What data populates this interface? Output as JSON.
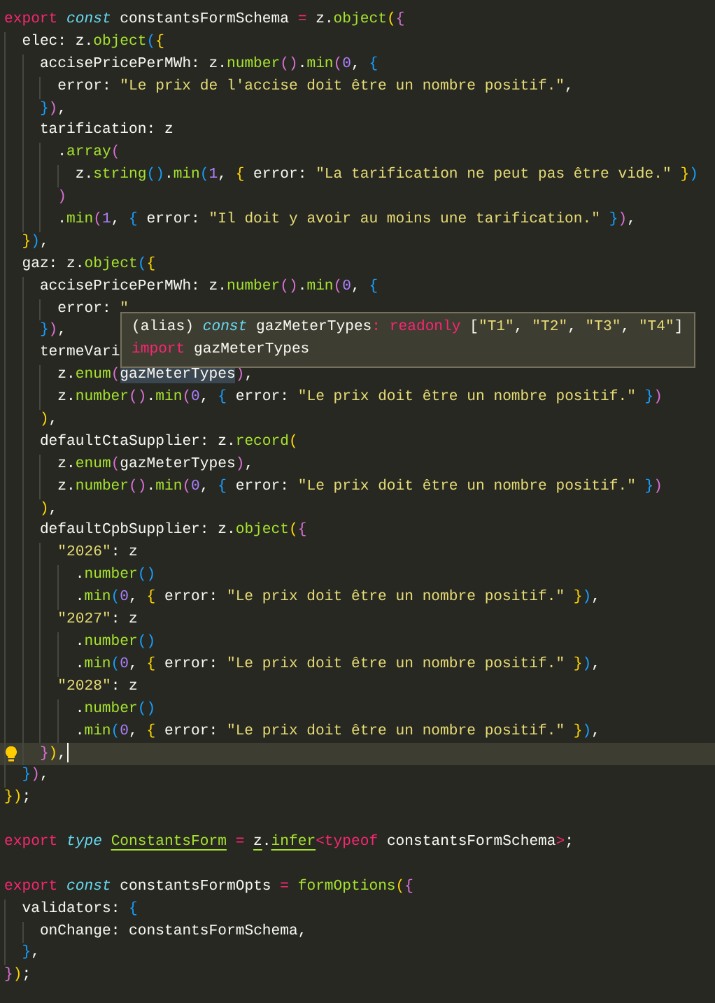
{
  "editor": {
    "blocks": [
      {
        "lines": [
          {
            "current": false,
            "tokens": [
              {
                "kind": "kw",
                "text": "export "
              },
              {
                "kind": "st",
                "text": "const "
              },
              {
                "kind": "p",
                "text": "constantsFormSchema "
              },
              {
                "kind": "op",
                "text": "= "
              },
              {
                "kind": "p",
                "text": "z."
              },
              {
                "kind": "fn",
                "text": "object"
              },
              {
                "kind": "p",
                "text": "({"
              }
            ]
          },
          {
            "current": false,
            "tokens": [
              {
                "kind": "p",
                "text": "  elec: z."
              },
              {
                "kind": "fn",
                "text": "object"
              },
              {
                "kind": "p",
                "text": "({"
              }
            ]
          },
          {
            "current": false,
            "tokens": [
              {
                "kind": "p",
                "text": "    accisePricePerMWh: z."
              },
              {
                "kind": "fn",
                "text": "number"
              },
              {
                "kind": "p",
                "text": "()."
              },
              {
                "kind": "fn",
                "text": "min"
              },
              {
                "kind": "p",
                "text": "("
              },
              {
                "kind": "num",
                "text": "0"
              },
              {
                "kind": "p",
                "text": ", {"
              }
            ]
          },
          {
            "current": false,
            "tokens": [
              {
                "kind": "p",
                "text": "      error: "
              },
              {
                "kind": "str",
                "text": "\"Le prix de l'accise doit être un nombre positif.\""
              },
              {
                "kind": "p",
                "text": ","
              }
            ]
          },
          {
            "current": false,
            "tokens": [
              {
                "kind": "p",
                "text": "    }),"
              }
            ]
          },
          {
            "current": false,
            "tokens": [
              {
                "kind": "p",
                "text": "    tarification: z"
              }
            ]
          },
          {
            "current": false,
            "tokens": [
              {
                "kind": "p",
                "text": "      ."
              },
              {
                "kind": "fn",
                "text": "array"
              },
              {
                "kind": "p",
                "text": "("
              }
            ]
          },
          {
            "current": false,
            "tokens": [
              {
                "kind": "p",
                "text": "        z."
              },
              {
                "kind": "fn",
                "text": "string"
              },
              {
                "kind": "p",
                "text": "()."
              },
              {
                "kind": "fn",
                "text": "min"
              },
              {
                "kind": "p",
                "text": "("
              },
              {
                "kind": "num",
                "text": "1"
              },
              {
                "kind": "p",
                "text": ", { error: "
              },
              {
                "kind": "str",
                "text": "\"La tarification ne peut pas être vide.\""
              },
              {
                "kind": "p",
                "text": " })"
              }
            ]
          },
          {
            "current": false,
            "tokens": [
              {
                "kind": "p",
                "text": "      )"
              }
            ]
          },
          {
            "current": false,
            "tokens": [
              {
                "kind": "p",
                "text": "      ."
              },
              {
                "kind": "fn",
                "text": "min"
              },
              {
                "kind": "p",
                "text": "("
              },
              {
                "kind": "num",
                "text": "1"
              },
              {
                "kind": "p",
                "text": ", { error: "
              },
              {
                "kind": "str",
                "text": "\"Il doit y avoir au moins une tarification.\""
              },
              {
                "kind": "p",
                "text": " }),"
              }
            ]
          },
          {
            "current": false,
            "tokens": [
              {
                "kind": "p",
                "text": "  }),"
              }
            ]
          },
          {
            "current": false,
            "tokens": [
              {
                "kind": "p",
                "text": "  gaz: z."
              },
              {
                "kind": "fn",
                "text": "object"
              },
              {
                "kind": "p",
                "text": "({"
              }
            ]
          },
          {
            "current": false,
            "tokens": [
              {
                "kind": "p",
                "text": "    accisePricePerMWh: z."
              },
              {
                "kind": "fn",
                "text": "number"
              },
              {
                "kind": "p",
                "text": "()."
              },
              {
                "kind": "fn",
                "text": "min"
              },
              {
                "kind": "p",
                "text": "("
              },
              {
                "kind": "num",
                "text": "0"
              },
              {
                "kind": "p",
                "text": ", {"
              }
            ]
          },
          {
            "current": false,
            "tokens": [
              {
                "kind": "p",
                "text": "      error: "
              },
              {
                "kind": "str",
                "text": "\""
              }
            ]
          },
          {
            "current": false,
            "tokens": [
              {
                "kind": "p",
                "text": "    }),"
              }
            ]
          },
          {
            "current": false,
            "tokens": [
              {
                "kind": "p",
                "text": "    termeVari"
              }
            ]
          },
          {
            "current": false,
            "tokens": [
              {
                "kind": "p",
                "text": "      z."
              },
              {
                "kind": "fn",
                "text": "enum"
              },
              {
                "kind": "p",
                "text": "("
              },
              {
                "kind": "hv",
                "text": "gazMeterTypes"
              },
              {
                "kind": "p",
                "text": "),"
              }
            ]
          },
          {
            "current": false,
            "tokens": [
              {
                "kind": "p",
                "text": "      z."
              },
              {
                "kind": "fn",
                "text": "number"
              },
              {
                "kind": "p",
                "text": "()."
              },
              {
                "kind": "fn",
                "text": "min"
              },
              {
                "kind": "p",
                "text": "("
              },
              {
                "kind": "num",
                "text": "0"
              },
              {
                "kind": "p",
                "text": ", { error: "
              },
              {
                "kind": "str",
                "text": "\"Le prix doit être un nombre positif.\""
              },
              {
                "kind": "p",
                "text": " })"
              }
            ]
          },
          {
            "current": false,
            "tokens": [
              {
                "kind": "p",
                "text": "    ),"
              }
            ]
          },
          {
            "current": false,
            "tokens": [
              {
                "kind": "p",
                "text": "    defaultCtaSupplier: z."
              },
              {
                "kind": "fn",
                "text": "record"
              },
              {
                "kind": "p",
                "text": "("
              }
            ]
          },
          {
            "current": false,
            "tokens": [
              {
                "kind": "p",
                "text": "      z."
              },
              {
                "kind": "fn",
                "text": "enum"
              },
              {
                "kind": "p",
                "text": "(gazMeterTypes),"
              }
            ]
          },
          {
            "current": false,
            "tokens": [
              {
                "kind": "p",
                "text": "      z."
              },
              {
                "kind": "fn",
                "text": "number"
              },
              {
                "kind": "p",
                "text": "()."
              },
              {
                "kind": "fn",
                "text": "min"
              },
              {
                "kind": "p",
                "text": "("
              },
              {
                "kind": "num",
                "text": "0"
              },
              {
                "kind": "p",
                "text": ", { error: "
              },
              {
                "kind": "str",
                "text": "\"Le prix doit être un nombre positif.\""
              },
              {
                "kind": "p",
                "text": " })"
              }
            ]
          },
          {
            "current": false,
            "tokens": [
              {
                "kind": "p",
                "text": "    ),"
              }
            ]
          },
          {
            "current": false,
            "tokens": [
              {
                "kind": "p",
                "text": "    defaultCpbSupplier: z."
              },
              {
                "kind": "fn",
                "text": "object"
              },
              {
                "kind": "p",
                "text": "({"
              }
            ]
          },
          {
            "current": false,
            "tokens": [
              {
                "kind": "str",
                "text": "      \"2026\""
              },
              {
                "kind": "p",
                "text": ": z"
              }
            ]
          },
          {
            "current": false,
            "tokens": [
              {
                "kind": "p",
                "text": "        ."
              },
              {
                "kind": "fn",
                "text": "number"
              },
              {
                "kind": "p",
                "text": "()"
              }
            ]
          },
          {
            "current": false,
            "tokens": [
              {
                "kind": "p",
                "text": "        ."
              },
              {
                "kind": "fn",
                "text": "min"
              },
              {
                "kind": "p",
                "text": "("
              },
              {
                "kind": "num",
                "text": "0"
              },
              {
                "kind": "p",
                "text": ", { error: "
              },
              {
                "kind": "str",
                "text": "\"Le prix doit être un nombre positif.\""
              },
              {
                "kind": "p",
                "text": " }),"
              }
            ]
          },
          {
            "current": false,
            "tokens": [
              {
                "kind": "str",
                "text": "      \"2027\""
              },
              {
                "kind": "p",
                "text": ": z"
              }
            ]
          },
          {
            "current": false,
            "tokens": [
              {
                "kind": "p",
                "text": "        ."
              },
              {
                "kind": "fn",
                "text": "number"
              },
              {
                "kind": "p",
                "text": "()"
              }
            ]
          },
          {
            "current": false,
            "tokens": [
              {
                "kind": "p",
                "text": "        ."
              },
              {
                "kind": "fn",
                "text": "min"
              },
              {
                "kind": "p",
                "text": "("
              },
              {
                "kind": "num",
                "text": "0"
              },
              {
                "kind": "p",
                "text": ", { error: "
              },
              {
                "kind": "str",
                "text": "\"Le prix doit être un nombre positif.\""
              },
              {
                "kind": "p",
                "text": " }),"
              }
            ]
          },
          {
            "current": false,
            "tokens": [
              {
                "kind": "str",
                "text": "      \"2028\""
              },
              {
                "kind": "p",
                "text": ": z"
              }
            ]
          },
          {
            "current": false,
            "tokens": [
              {
                "kind": "p",
                "text": "        ."
              },
              {
                "kind": "fn",
                "text": "number"
              },
              {
                "kind": "p",
                "text": "()"
              }
            ]
          },
          {
            "current": false,
            "tokens": [
              {
                "kind": "p",
                "text": "        ."
              },
              {
                "kind": "fn",
                "text": "min"
              },
              {
                "kind": "p",
                "text": "("
              },
              {
                "kind": "num",
                "text": "0"
              },
              {
                "kind": "p",
                "text": ", { error: "
              },
              {
                "kind": "str",
                "text": "\"Le prix doit être un nombre positif.\""
              },
              {
                "kind": "p",
                "text": " }),"
              }
            ]
          },
          {
            "current": true,
            "tokens": [
              {
                "kind": "p",
                "text": "    }),"
              }
            ]
          },
          {
            "current": false,
            "tokens": [
              {
                "kind": "p",
                "text": "  }),"
              }
            ]
          },
          {
            "current": false,
            "tokens": [
              {
                "kind": "p",
                "text": "});"
              }
            ]
          }
        ]
      },
      {
        "lines": [
          {
            "current": false,
            "tokens": [
              {
                "kind": "kw",
                "text": "export "
              },
              {
                "kind": "st",
                "text": "type "
              },
              {
                "kind": "fnu",
                "text": "ConstantsForm"
              },
              {
                "kind": "op",
                "text": " = "
              },
              {
                "kind": "u",
                "text": "z"
              },
              {
                "kind": "p",
                "text": "."
              },
              {
                "kind": "fnu",
                "text": "infer"
              },
              {
                "kind": "op",
                "text": "<"
              },
              {
                "kind": "kw",
                "text": "typeof "
              },
              {
                "kind": "p",
                "text": "constantsFormSchema"
              },
              {
                "kind": "op",
                "text": ">"
              },
              {
                "kind": "p",
                "text": ";"
              }
            ]
          }
        ]
      },
      {
        "lines": [
          {
            "current": false,
            "tokens": [
              {
                "kind": "kw",
                "text": "export "
              },
              {
                "kind": "st",
                "text": "const "
              },
              {
                "kind": "p",
                "text": "constantsFormOpts "
              },
              {
                "kind": "op",
                "text": "= "
              },
              {
                "kind": "fn",
                "text": "formOptions"
              },
              {
                "kind": "p",
                "text": "({"
              }
            ]
          },
          {
            "current": false,
            "tokens": [
              {
                "kind": "p",
                "text": "  validators: {"
              }
            ]
          },
          {
            "current": false,
            "tokens": [
              {
                "kind": "p",
                "text": "    onChange: constantsFormSchema,"
              }
            ]
          },
          {
            "current": false,
            "tokens": [
              {
                "kind": "p",
                "text": "  },"
              }
            ]
          },
          {
            "current": false,
            "tokens": [
              {
                "kind": "p",
                "text": "});"
              }
            ]
          }
        ]
      }
    ]
  },
  "hover_tooltip": {
    "lines": [
      {
        "tokens": [
          {
            "kind": "p",
            "text": "(alias) "
          },
          {
            "kind": "st",
            "text": "const "
          },
          {
            "kind": "p",
            "text": "gazMeterTypes"
          },
          {
            "kind": "op",
            "text": ": "
          },
          {
            "kind": "kw",
            "text": "readonly "
          },
          {
            "kind": "p",
            "text": "["
          },
          {
            "kind": "str",
            "text": "\"T1\""
          },
          {
            "kind": "p",
            "text": ", "
          },
          {
            "kind": "str",
            "text": "\"T2\""
          },
          {
            "kind": "p",
            "text": ", "
          },
          {
            "kind": "str",
            "text": "\"T3\""
          },
          {
            "kind": "p",
            "text": ", "
          },
          {
            "kind": "str",
            "text": "\"T4\""
          },
          {
            "kind": "p",
            "text": "]"
          }
        ]
      },
      {
        "tokens": [
          {
            "kind": "kw",
            "text": "import "
          },
          {
            "kind": "p",
            "text": "gazMeterTypes"
          }
        ]
      }
    ]
  }
}
